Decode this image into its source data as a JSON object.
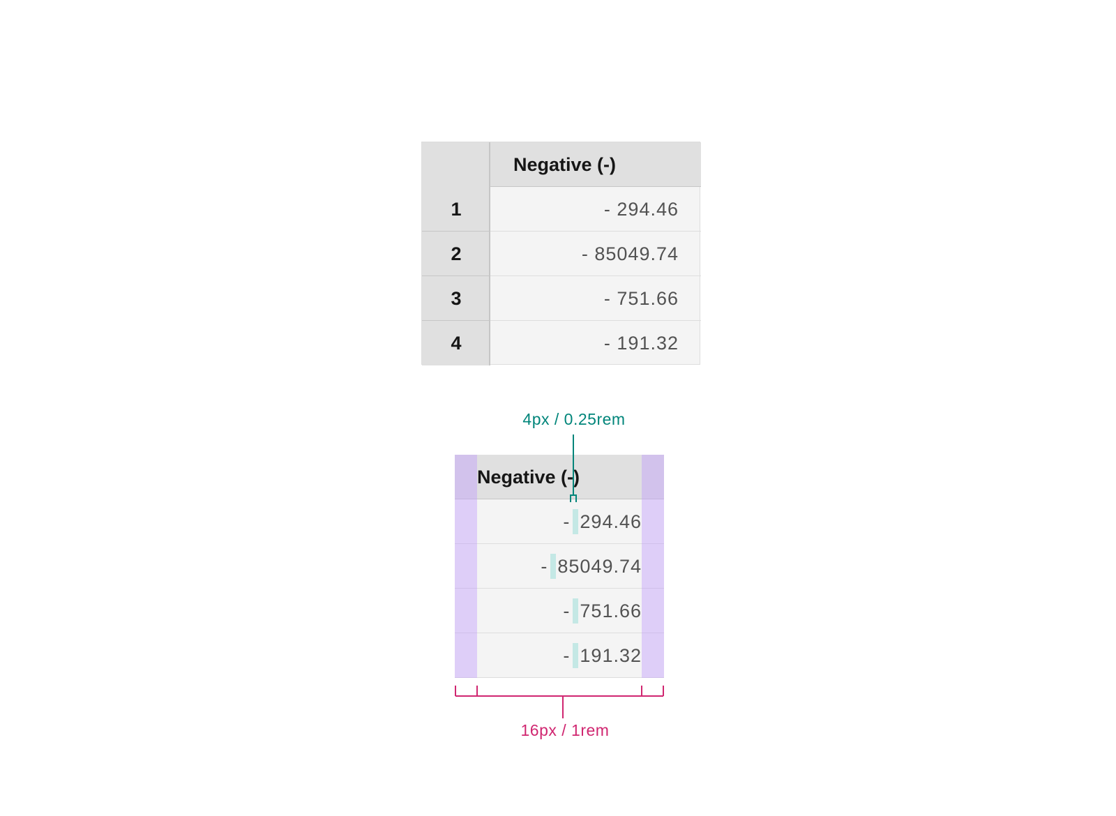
{
  "table_top": {
    "header": "Negative (-)",
    "rows": [
      {
        "index": "1",
        "value": "- 294.46"
      },
      {
        "index": "2",
        "value": "- 85049.74"
      },
      {
        "index": "3",
        "value": "- 751.66"
      },
      {
        "index": "4",
        "value": "- 191.32"
      }
    ]
  },
  "table_spec": {
    "header": "Negative (-)",
    "rows": [
      {
        "sign": "-",
        "number": "294.46"
      },
      {
        "sign": "-",
        "number": "85049.74"
      },
      {
        "sign": "-",
        "number": "751.66"
      },
      {
        "sign": "-",
        "number": "191.32"
      }
    ]
  },
  "annotations": {
    "sign_gap": "4px / 0.25rem",
    "cell_padding": "16px / 1rem"
  },
  "colors": {
    "header_bg": "#e0e0e0",
    "cell_bg": "#f4f4f4",
    "padding_highlight": "#dcc9fa",
    "gap_highlight": "#c4e8e5",
    "teal": "#00857a",
    "magenta": "#d02670"
  }
}
